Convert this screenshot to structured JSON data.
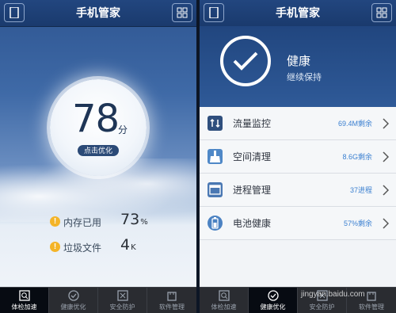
{
  "left": {
    "title": "手机管家",
    "score": "78",
    "score_unit": "分",
    "optimize_label": "点击优化",
    "stats": [
      {
        "label": "内存已用",
        "value": "73",
        "unit": "%"
      },
      {
        "label": "垃圾文件",
        "value": "4",
        "unit": "K"
      }
    ],
    "tabs": [
      {
        "label": "体检加速",
        "icon": "search-icon",
        "active": true
      },
      {
        "label": "健康优化",
        "icon": "check-icon",
        "active": false
      },
      {
        "label": "安全防护",
        "icon": "shield-icon",
        "active": false
      },
      {
        "label": "软件管理",
        "icon": "bag-icon",
        "active": false
      }
    ]
  },
  "right": {
    "title": "手机管家",
    "health_title": "健康",
    "health_sub": "继续保持",
    "items": [
      {
        "label": "流量监控",
        "value": "69.4M剩余",
        "icon": "traffic-icon",
        "color": "#2f4f7d"
      },
      {
        "label": "空间清理",
        "value": "8.6G剩余",
        "icon": "broom-icon",
        "color": "#4f88c7"
      },
      {
        "label": "进程管理",
        "value": "37进程",
        "icon": "process-icon",
        "color": "#4a78b3"
      },
      {
        "label": "电池健康",
        "value": "57%剩余",
        "icon": "battery-icon",
        "color": "#4b82c2"
      }
    ],
    "tabs": [
      {
        "label": "体检加速",
        "icon": "search-icon",
        "active": false
      },
      {
        "label": "健康优化",
        "icon": "check-icon",
        "active": true
      },
      {
        "label": "安全防护",
        "icon": "shield-icon",
        "active": false
      },
      {
        "label": "软件管理",
        "icon": "bag-icon",
        "active": false
      }
    ]
  },
  "watermark": "jingyan.baidu.com",
  "colors": {
    "accent": "#3a7fd0",
    "header": "#1f427a",
    "warning": "#f4b428"
  }
}
